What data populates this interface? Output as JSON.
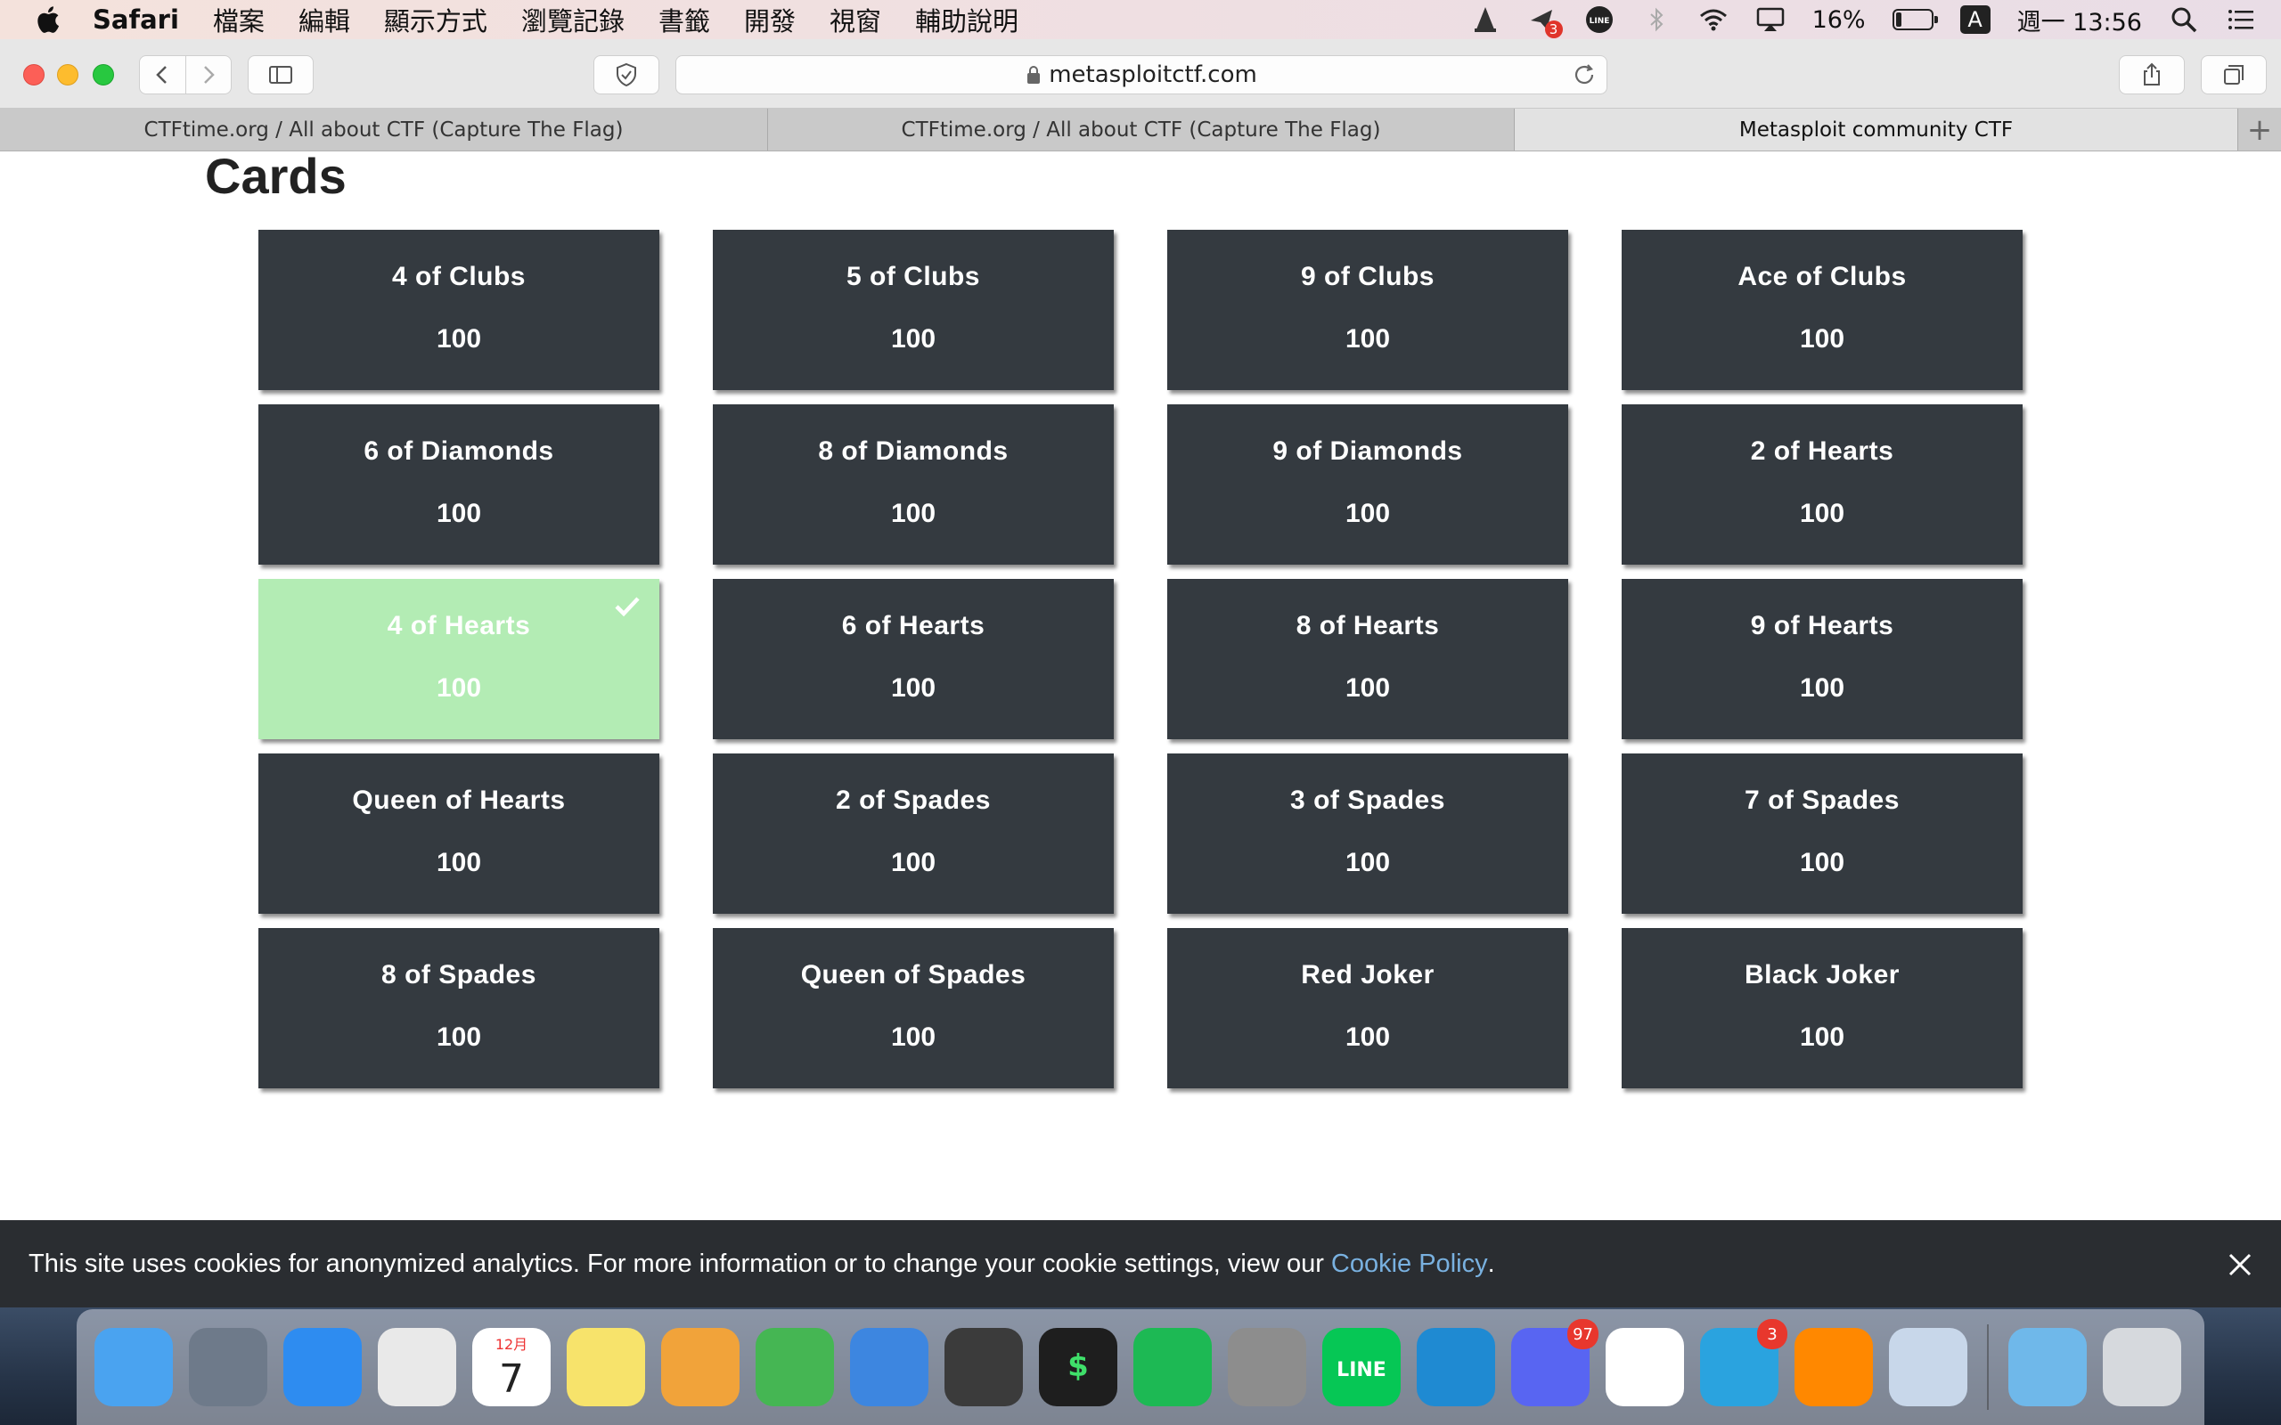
{
  "menubar": {
    "app_name": "Safari",
    "menus": [
      "檔案",
      "編輯",
      "顯示方式",
      "瀏覽記錄",
      "書籤",
      "開發",
      "視窗",
      "輔助說明"
    ],
    "notification_badge": "3",
    "line_label": "LINE",
    "input_method": "A",
    "battery_percent": "16%",
    "battery_level": 0.16,
    "clock": "週一 13:56"
  },
  "toolbar": {
    "url": "metasploitctf.com"
  },
  "tabs": [
    {
      "title": "CTFtime.org / All about CTF (Capture The Flag)",
      "active": false
    },
    {
      "title": "CTFtime.org / All about CTF (Capture The Flag)",
      "active": false
    },
    {
      "title": "Metasploit community CTF",
      "active": true
    }
  ],
  "page": {
    "title": "Cards",
    "cards": [
      {
        "name": "4 of Clubs",
        "points": "100",
        "solved": false
      },
      {
        "name": "5 of Clubs",
        "points": "100",
        "solved": false
      },
      {
        "name": "9 of Clubs",
        "points": "100",
        "solved": false
      },
      {
        "name": "Ace of Clubs",
        "points": "100",
        "solved": false
      },
      {
        "name": "6 of Diamonds",
        "points": "100",
        "solved": false
      },
      {
        "name": "8 of Diamonds",
        "points": "100",
        "solved": false
      },
      {
        "name": "9 of Diamonds",
        "points": "100",
        "solved": false
      },
      {
        "name": "2 of Hearts",
        "points": "100",
        "solved": false
      },
      {
        "name": "4 of Hearts",
        "points": "100",
        "solved": true
      },
      {
        "name": "6 of Hearts",
        "points": "100",
        "solved": false
      },
      {
        "name": "8 of Hearts",
        "points": "100",
        "solved": false
      },
      {
        "name": "9 of Hearts",
        "points": "100",
        "solved": false
      },
      {
        "name": "Queen of Hearts",
        "points": "100",
        "solved": false
      },
      {
        "name": "2 of Spades",
        "points": "100",
        "solved": false
      },
      {
        "name": "3 of Spades",
        "points": "100",
        "solved": false
      },
      {
        "name": "7 of Spades",
        "points": "100",
        "solved": false
      },
      {
        "name": "8 of Spades",
        "points": "100",
        "solved": false
      },
      {
        "name": "Queen of Spades",
        "points": "100",
        "solved": false
      },
      {
        "name": "Red Joker",
        "points": "100",
        "solved": false
      },
      {
        "name": "Black Joker",
        "points": "100",
        "solved": false
      }
    ]
  },
  "cookie_banner": {
    "text": "This site uses cookies for anonymized analytics. For more information or to change your cookie settings, view our",
    "link": "Cookie Policy",
    "suffix": "."
  },
  "dock": {
    "apps": [
      {
        "name": "finder",
        "color": "#4aa3f0"
      },
      {
        "name": "launchpad",
        "color": "#6e7a8a"
      },
      {
        "name": "safari",
        "color": "#2e8cf0"
      },
      {
        "name": "chrome",
        "color": "#e9e9e9"
      },
      {
        "name": "calendar",
        "color": "#ffffff",
        "month": "12月",
        "day": "7"
      },
      {
        "name": "notes",
        "color": "#f7e36b"
      },
      {
        "name": "pages",
        "color": "#f1a33a"
      },
      {
        "name": "numbers",
        "color": "#45b653"
      },
      {
        "name": "keynote",
        "color": "#3d86e0"
      },
      {
        "name": "sublime-text",
        "color": "#3b3b3b"
      },
      {
        "name": "terminal",
        "color": "#1e1e1e",
        "glyph": "$"
      },
      {
        "name": "spotify",
        "color": "#1db954"
      },
      {
        "name": "system-preferences",
        "color": "#8d8d8d"
      },
      {
        "name": "line",
        "color": "#06c755",
        "glyph": "LINE"
      },
      {
        "name": "vscode",
        "color": "#1f8ad2"
      },
      {
        "name": "discord",
        "color": "#5865f2",
        "badge": "97"
      },
      {
        "name": "slack",
        "color": "#ffffff"
      },
      {
        "name": "telegram",
        "color": "#2aa3df",
        "badge": "3"
      },
      {
        "name": "vlc",
        "color": "#ff8800"
      },
      {
        "name": "preview",
        "color": "#c8d7ea"
      },
      {
        "name": "downloads-folder",
        "color": "#6fb8ea"
      },
      {
        "name": "trash",
        "color": "#d6d9dd"
      }
    ]
  }
}
